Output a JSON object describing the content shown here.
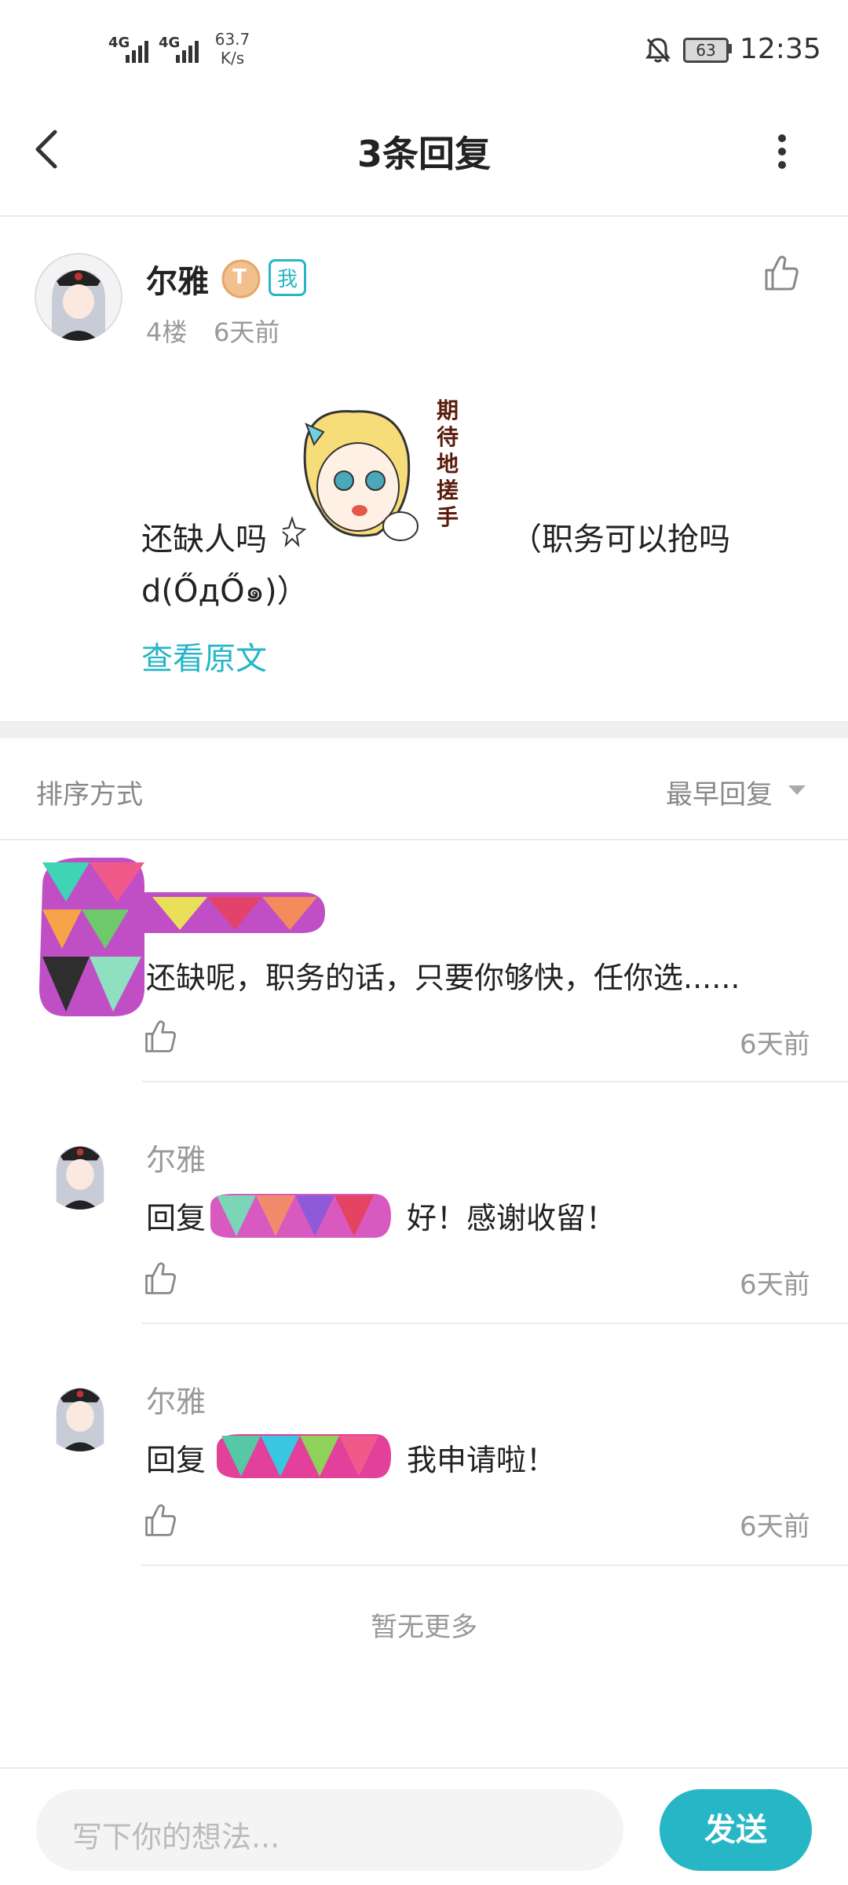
{
  "status_bar": {
    "signal1": "4G",
    "signal2": "4G",
    "net_speed_value": "63.7",
    "net_speed_unit": "K/s",
    "battery": "63",
    "time": "12:35"
  },
  "header": {
    "title": "3条回复",
    "back_icon": "chevron-left-icon",
    "more_icon": "more-vertical-icon"
  },
  "post": {
    "username": "尔雅",
    "level_badge": "T",
    "me_badge": "我",
    "floor": "4楼",
    "time": "6天前",
    "text_before_sticker": "还缺人吗",
    "text_after_sticker": "（职务可以抢吗",
    "text_line2": "d(ŐдŐ๑)）",
    "sticker_caption": "期待地搓手",
    "view_original": "查看原文"
  },
  "sort": {
    "label": "排序方式",
    "value": "最早回复"
  },
  "replies": [
    {
      "text": "还缺呢，职务的话，只要你够快，任你选......",
      "time": "6天前"
    },
    {
      "name": "尔雅",
      "prefix": "回复",
      "text": "好！感谢收留！",
      "time": "6天前"
    },
    {
      "name": "尔雅",
      "prefix": "回复",
      "text": "我申请啦！",
      "time": "6天前"
    }
  ],
  "no_more": "暂无更多",
  "composer": {
    "placeholder": "写下你的想法...",
    "send_label": "发送"
  },
  "colors": {
    "accent": "#26b6c6"
  }
}
